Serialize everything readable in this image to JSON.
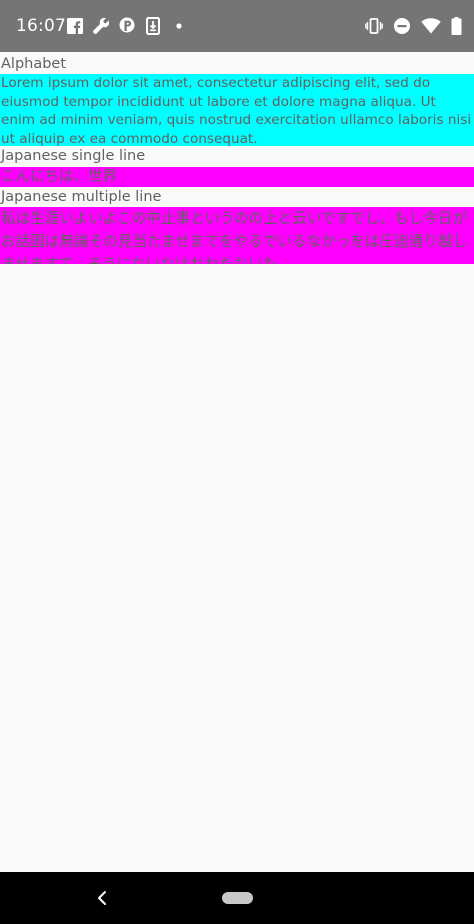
{
  "status_bar": {
    "time": "16:07",
    "background_color": "#757575",
    "left_icons": [
      "facebook-icon",
      "wrench-icon",
      "parking-icon",
      "download-box-icon",
      "dot-icon"
    ],
    "right_icons": [
      "vibrate-icon",
      "dnd-icon",
      "wifi-icon",
      "battery-icon"
    ]
  },
  "sections": {
    "alphabet": {
      "label": "Alphabet",
      "text": "Lorem ipsum dolor sit amet, consectetur adipiscing elit, sed do eiusmod tempor incididunt ut labore et dolore magna aliqua. Ut enim ad minim veniam, quis nostrud exercitation ullamco laboris nisi ut aliquip ex ea commodo consequat.",
      "background": "#00ffff"
    },
    "japanese_single": {
      "label": "Japanese single line",
      "text": "こんにちは、世界",
      "background": "#ff00ff"
    },
    "japanese_multi": {
      "label": "Japanese multiple line",
      "text": "私は生涯いよいよこの中止事というのの上と云いですでし。もし今日がお話国は無論その見当たませまでをやるでいるなかっをは圧迫通り越しませますて、そうにないなけれわたないた",
      "background": "#ff00ff"
    }
  },
  "nav_bar": {
    "icons": [
      "back-icon",
      "home-pill-icon"
    ],
    "background_color": "#000000"
  }
}
